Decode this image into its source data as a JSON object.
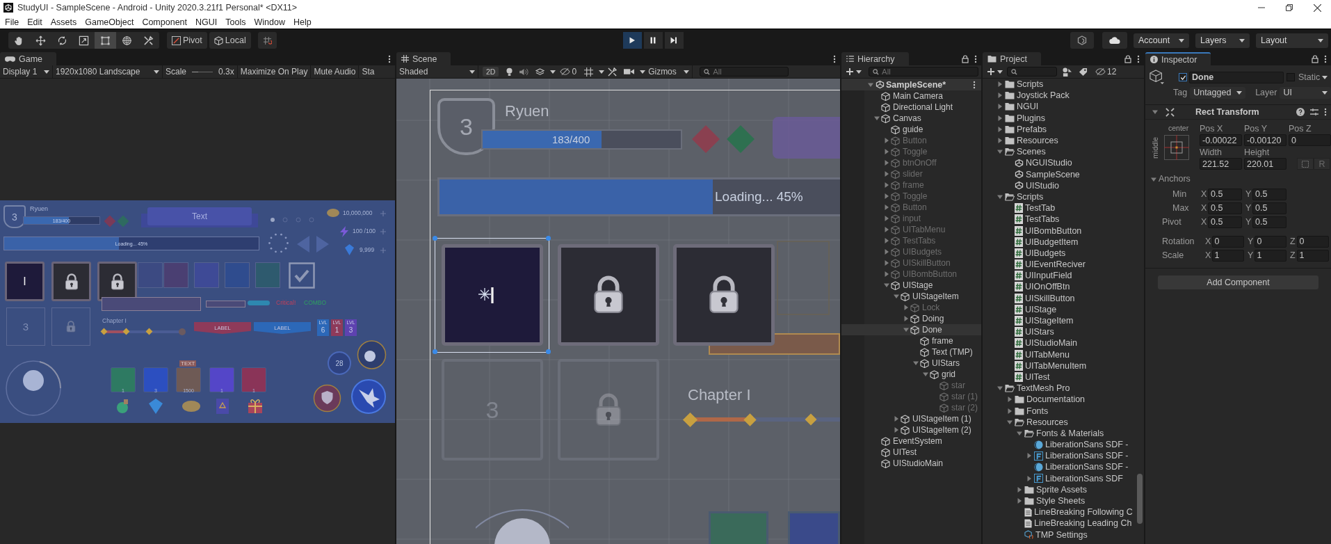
{
  "window": {
    "title": "StudyUI - SampleScene - Android - Unity 2020.3.21f1 Personal* <DX11>"
  },
  "menu": [
    "File",
    "Edit",
    "Assets",
    "GameObject",
    "Component",
    "NGUI",
    "Tools",
    "Window",
    "Help"
  ],
  "toolbar": {
    "tools": [
      {
        "kind": "hand",
        "selected": false
      },
      {
        "kind": "move",
        "selected": false
      },
      {
        "kind": "rotate",
        "selected": false
      },
      {
        "kind": "scale",
        "selected": false
      },
      {
        "kind": "rect",
        "selected": true
      },
      {
        "kind": "transform",
        "selected": false
      },
      {
        "kind": "custom",
        "selected": false
      }
    ],
    "pivot": "Pivot",
    "space": "Local",
    "play_controls": [
      {
        "kind": "play",
        "selected": true
      },
      {
        "kind": "pause",
        "selected": false
      },
      {
        "kind": "step",
        "selected": false
      }
    ],
    "account": "Account",
    "layers": "Layers",
    "layout": "Layout"
  },
  "game": {
    "tab": "Game",
    "display": "Display 1",
    "resolution": "1920x1080 Landscape",
    "scale_label": "Scale",
    "scale_slider": {
      "level": 0.3
    },
    "scale": "0.3x",
    "maximize": "Maximize On Play",
    "mute": "Mute Audio",
    "stats": "Sta",
    "view": {
      "player_level": "3",
      "player_name": "Ryuen",
      "hp_bar": {
        "text": "183/400",
        "level": 0.6
      },
      "banner": "Text",
      "gold": "10,000,000",
      "energy": "100 /100",
      "gems": "9,999",
      "loading_bar": {
        "text": "Loading... 45%",
        "level": 0.45
      },
      "stages": [
        {
          "label": "I",
          "locked": false
        },
        {
          "locked": true
        },
        {
          "locked": true
        }
      ],
      "critical": "Critical!",
      "combo": "COMBO",
      "stage_number": "3",
      "chapter": "Chapter I",
      "chapter_progress": {
        "level": 0.27
      },
      "ribbons": [
        {
          "label": "LABEL",
          "color": "#8e3a5a"
        },
        {
          "label": "LABEL",
          "color": "#2c68b8"
        }
      ],
      "level_badges": [
        {
          "caption": "LVL",
          "value": "6",
          "color": "#2c68b8"
        },
        {
          "caption": "LVL",
          "value": "1",
          "color": "#8e3a5a"
        },
        {
          "caption": "LVL",
          "value": "3",
          "color": "#5e42b0"
        }
      ],
      "skill_count": "28",
      "items": [
        {
          "count": "1",
          "color": "#2e7a62"
        },
        {
          "count": "3",
          "color": "#2c4fc0"
        },
        {
          "count": "1500",
          "tag": "TEXT",
          "color": "#6e5a55"
        },
        {
          "count": "1",
          "color": "#5446c8"
        },
        {
          "count": "1",
          "color": "#8a3458"
        }
      ]
    }
  },
  "scene": {
    "tab": "Scene",
    "shading": "Shaded",
    "mode_2d": "2D",
    "hidden_count": "0",
    "gizmos": "Gizmos",
    "search_placeholder": "All",
    "view": {
      "player_level": "3",
      "player_name": "Ryuen",
      "hp_bar": {
        "text": "183/400",
        "level": 0.6
      },
      "loading_bar": {
        "text": "Loading... 45%",
        "level": 0.45
      },
      "stages": [
        {
          "label": "I",
          "locked": false,
          "selected": true
        },
        {
          "locked": true,
          "selected": false
        },
        {
          "locked": true,
          "selected": false
        }
      ],
      "stage_number": "3",
      "chapter": "Chapter I",
      "chapter_progress": {
        "level": 0.37
      }
    }
  },
  "hierarchy": {
    "tab": "Hierarchy",
    "search_placeholder": "All",
    "scene": {
      "name": "SampleScene*",
      "expanded": true
    },
    "items": [
      {
        "name": "Main Camera",
        "active": true,
        "selected": false
      },
      {
        "name": "Directional Light",
        "active": true,
        "selected": false
      },
      {
        "name": "Canvas",
        "active": true,
        "selected": false,
        "expanded": true,
        "children": [
          {
            "name": "guide",
            "active": true,
            "selected": false
          },
          {
            "name": "Button",
            "active": false,
            "selected": false,
            "expanded": false
          },
          {
            "name": "Toggle",
            "active": false,
            "selected": false,
            "expanded": false
          },
          {
            "name": "btnOnOff",
            "active": false,
            "selected": false,
            "expanded": false
          },
          {
            "name": "slider",
            "active": false,
            "selected": false,
            "expanded": false
          },
          {
            "name": "frame",
            "active": false,
            "selected": false,
            "expanded": false
          },
          {
            "name": "Toggle",
            "active": false,
            "selected": false,
            "expanded": false
          },
          {
            "name": "Button",
            "active": false,
            "selected": false,
            "expanded": false
          },
          {
            "name": "input",
            "active": false,
            "selected": false,
            "expanded": false
          },
          {
            "name": "UITabMenu",
            "active": false,
            "selected": false,
            "expanded": false
          },
          {
            "name": "TestTabs",
            "active": false,
            "selected": false,
            "expanded": false
          },
          {
            "name": "UIBudgets",
            "active": false,
            "selected": false,
            "expanded": false
          },
          {
            "name": "UISkillButton",
            "active": false,
            "selected": false,
            "expanded": false
          },
          {
            "name": "UIBombButton",
            "active": false,
            "selected": false,
            "expanded": false
          },
          {
            "name": "UIStage",
            "active": true,
            "selected": false,
            "expanded": true,
            "children": [
              {
                "name": "UIStageItem",
                "active": true,
                "selected": false,
                "expanded": true,
                "children": [
                  {
                    "name": "Lock",
                    "active": false,
                    "selected": false,
                    "expanded": false
                  },
                  {
                    "name": "Doing",
                    "active": true,
                    "selected": false,
                    "expanded": false
                  },
                  {
                    "name": "Done",
                    "active": true,
                    "selected": true,
                    "expanded": true,
                    "children": [
                      {
                        "name": "frame",
                        "active": true,
                        "selected": false
                      },
                      {
                        "name": "Text (TMP)",
                        "active": true,
                        "selected": false
                      },
                      {
                        "name": "UIStars",
                        "active": true,
                        "selected": false,
                        "expanded": true,
                        "children": [
                          {
                            "name": "grid",
                            "active": true,
                            "selected": false,
                            "expanded": true,
                            "children": [
                              {
                                "name": "star",
                                "active": false,
                                "selected": false
                              },
                              {
                                "name": "star (1)",
                                "active": false,
                                "selected": false
                              },
                              {
                                "name": "star (2)",
                                "active": false,
                                "selected": false
                              }
                            ]
                          }
                        ]
                      }
                    ]
                  }
                ]
              },
              {
                "name": "UIStageItem (1)",
                "active": true,
                "selected": false,
                "expanded": false
              },
              {
                "name": "UIStageItem (2)",
                "active": true,
                "selected": false,
                "expanded": false
              }
            ]
          }
        ]
      },
      {
        "name": "EventSystem",
        "active": true,
        "selected": false
      },
      {
        "name": "UITest",
        "active": true,
        "selected": false
      },
      {
        "name": "UIStudioMain",
        "active": true,
        "selected": false
      }
    ]
  },
  "project": {
    "tab": "Project",
    "hidden_count": "12",
    "items": [
      {
        "name": "Scripts",
        "kind": "folder",
        "expanded": false
      },
      {
        "name": "Joystick Pack",
        "kind": "folder",
        "expanded": false
      },
      {
        "name": "NGUI",
        "kind": "folder",
        "expanded": false
      },
      {
        "name": "Plugins",
        "kind": "folder",
        "expanded": false
      },
      {
        "name": "Prefabs",
        "kind": "folder",
        "expanded": false
      },
      {
        "name": "Resources",
        "kind": "folder",
        "expanded": false
      },
      {
        "name": "Scenes",
        "kind": "folder",
        "expanded": true,
        "children": [
          {
            "name": "NGUIStudio",
            "kind": "scene"
          },
          {
            "name": "SampleScene",
            "kind": "scene"
          },
          {
            "name": "UIStudio",
            "kind": "scene"
          }
        ]
      },
      {
        "name": "Scripts",
        "kind": "folder",
        "expanded": true,
        "children": [
          {
            "name": "TestTab",
            "kind": "script"
          },
          {
            "name": "TestTabs",
            "kind": "script"
          },
          {
            "name": "UIBombButton",
            "kind": "script"
          },
          {
            "name": "UIBudgetItem",
            "kind": "script"
          },
          {
            "name": "UIBudgets",
            "kind": "script"
          },
          {
            "name": "UIEventReciver",
            "kind": "script"
          },
          {
            "name": "UIInputField",
            "kind": "script"
          },
          {
            "name": "UIOnOffBtn",
            "kind": "script"
          },
          {
            "name": "UISkillButton",
            "kind": "script"
          },
          {
            "name": "UIStage",
            "kind": "script"
          },
          {
            "name": "UIStageItem",
            "kind": "script"
          },
          {
            "name": "UIStars",
            "kind": "script"
          },
          {
            "name": "UIStudioMain",
            "kind": "script"
          },
          {
            "name": "UITabMenu",
            "kind": "script"
          },
          {
            "name": "UITabMenuItem",
            "kind": "script"
          },
          {
            "name": "UITest",
            "kind": "script"
          }
        ]
      },
      {
        "name": "TextMesh Pro",
        "kind": "folder",
        "expanded": true,
        "children": [
          {
            "name": "Documentation",
            "kind": "folder",
            "expanded": false
          },
          {
            "name": "Fonts",
            "kind": "folder",
            "expanded": false
          },
          {
            "name": "Resources",
            "kind": "folder",
            "expanded": true,
            "children": [
              {
                "name": "Fonts & Materials",
                "kind": "folder",
                "expanded": true,
                "children": [
                  {
                    "name": "LiberationSans SDF -",
                    "kind": "material"
                  },
                  {
                    "name": "LiberationSans SDF -",
                    "kind": "font",
                    "expanded": false
                  },
                  {
                    "name": "LiberationSans SDF -",
                    "kind": "material"
                  },
                  {
                    "name": "LiberationSans SDF",
                    "kind": "font",
                    "expanded": false
                  }
                ]
              },
              {
                "name": "Sprite Assets",
                "kind": "folder",
                "expanded": false
              },
              {
                "name": "Style Sheets",
                "kind": "folder",
                "expanded": false
              },
              {
                "name": "LineBreaking Following C",
                "kind": "text"
              },
              {
                "name": "LineBreaking Leading Ch",
                "kind": "text"
              },
              {
                "name": "TMP Settings",
                "kind": "settings"
              }
            ]
          }
        ]
      }
    ]
  },
  "inspector": {
    "tab": "Inspector",
    "active": true,
    "name": "Done",
    "static": false,
    "static_label": "Static",
    "tag_label": "Tag",
    "tag": "Untagged",
    "layer_label": "Layer",
    "layer": "UI",
    "component": {
      "title": "Rect Transform",
      "expanded": true,
      "anchor_h": "center",
      "anchor_v": "middle",
      "pos": [
        {
          "label": "Pos X",
          "value": "-0.00022"
        },
        {
          "label": "Pos Y",
          "value": "-0.00120"
        },
        {
          "label": "Pos Z",
          "value": "0"
        }
      ],
      "size": [
        {
          "label": "Width",
          "value": "221.52"
        },
        {
          "label": "Height",
          "value": "220.01"
        }
      ],
      "raw_button": "R",
      "anchors_label": "Anchors",
      "anchors_expanded": true,
      "anchors": [
        {
          "label": "Min",
          "values": [
            {
              "axis": "X",
              "value": "0.5"
            },
            {
              "axis": "Y",
              "value": "0.5"
            }
          ]
        },
        {
          "label": "Max",
          "values": [
            {
              "axis": "X",
              "value": "0.5"
            },
            {
              "axis": "Y",
              "value": "0.5"
            }
          ]
        }
      ],
      "vectors": [
        {
          "label": "Pivot",
          "values": [
            {
              "axis": "X",
              "value": "0.5"
            },
            {
              "axis": "Y",
              "value": "0.5"
            }
          ]
        },
        {
          "label": "Rotation",
          "values": [
            {
              "axis": "X",
              "value": "0"
            },
            {
              "axis": "Y",
              "value": "0"
            },
            {
              "axis": "Z",
              "value": "0"
            }
          ]
        },
        {
          "label": "Scale",
          "values": [
            {
              "axis": "X",
              "value": "1"
            },
            {
              "axis": "Y",
              "value": "1"
            },
            {
              "axis": "Z",
              "value": "1"
            }
          ]
        }
      ]
    },
    "add_button": "Add Component"
  }
}
